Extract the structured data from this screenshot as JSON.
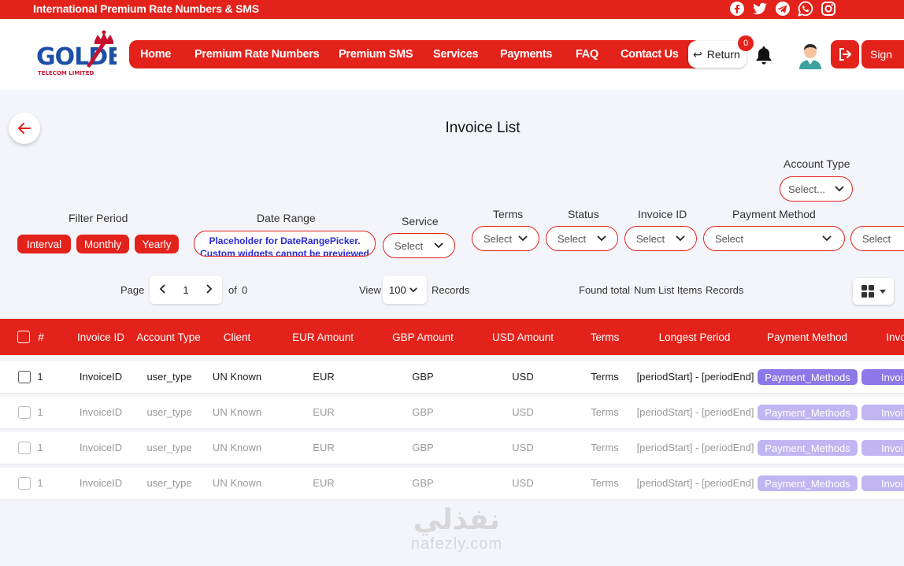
{
  "topbar": {
    "tagline": "International Premium Rate Numbers & SMS",
    "socials": [
      "facebook-icon",
      "twitter-icon",
      "telegram-icon",
      "whatsapp-icon",
      "instagram-icon"
    ]
  },
  "brand": {
    "name": "GOLDEX",
    "subtitle": "TELECOM LIMITED"
  },
  "nav": {
    "items": [
      "Home",
      "Premium Rate Numbers",
      "Premium SMS",
      "Services",
      "Payments",
      "FAQ",
      "Contact Us"
    ],
    "return_label": "Return",
    "notification_count": "0",
    "signin_label": "Sign"
  },
  "page": {
    "title": "Invoice List"
  },
  "filters": {
    "filter_period_label": "Filter Period",
    "period_buttons": [
      "Interval",
      "Monthly",
      "Yearly"
    ],
    "date_range_label": "Date Range",
    "date_range_text": "Placeholder for DateRangePicker. Custom widgets cannot be previewed",
    "service_label": "Service",
    "service_value": "Select",
    "terms_label": "Terms",
    "terms_value": "Select",
    "status_label": "Status",
    "status_value": "Select",
    "invoice_id_label": "Invoice ID",
    "invoice_id_value": "Select",
    "payment_method_label": "Payment Method",
    "payment_method_value": "Select",
    "extra_value": "Select",
    "account_type_label": "Account Type",
    "account_type_value": "Select..."
  },
  "pagination": {
    "page_label": "Page",
    "page_value": "1",
    "of_label": "of",
    "total_pages": "0",
    "view_label": "View",
    "view_value": "100",
    "records_label": "Records",
    "found_label": "Found total",
    "found_value": "Num List Items",
    "found_suffix": "Records"
  },
  "table": {
    "headers": [
      "#",
      "Invoice ID",
      "Account Type",
      "Client",
      "EUR Amount",
      "GBP Amount",
      "USD Amount",
      "Terms",
      "Longest Period",
      "Payment Method",
      "Invo"
    ],
    "rows": [
      {
        "num": "1",
        "invoice_id": "InvoiceID",
        "account_type": "user_type",
        "client": "UN Known",
        "eur": "EUR",
        "gbp": "GBP",
        "usd": "USD",
        "terms": "Terms",
        "period": "[periodStart] - [periodEnd]",
        "payment": "Payment_Methods",
        "invoice": "Invoi"
      },
      {
        "num": "1",
        "invoice_id": "InvoiceID",
        "account_type": "user_type",
        "client": "UN Known",
        "eur": "EUR",
        "gbp": "GBP",
        "usd": "USD",
        "terms": "Terms",
        "period": "[periodStart] - [periodEnd]",
        "payment": "Payment_Methods",
        "invoice": "Invoi"
      },
      {
        "num": "1",
        "invoice_id": "InvoiceID",
        "account_type": "user_type",
        "client": "UN Known",
        "eur": "EUR",
        "gbp": "GBP",
        "usd": "USD",
        "terms": "Terms",
        "period": "[periodStart] - [periodEnd]",
        "payment": "Payment_Methods",
        "invoice": "Invoi"
      },
      {
        "num": "1",
        "invoice_id": "InvoiceID",
        "account_type": "user_type",
        "client": "UN Known",
        "eur": "EUR",
        "gbp": "GBP",
        "usd": "USD",
        "terms": "Terms",
        "period": "[periodStart] - [periodEnd]",
        "payment": "Payment_Methods",
        "invoice": "Invoi"
      }
    ]
  },
  "watermark": {
    "arabic": "نفذلي",
    "latin": "nafezly.com"
  },
  "colors": {
    "brand_red": "#e3221b",
    "tag_purple": "#8c78e6",
    "tag_purple_faded": "#c1b6f1",
    "date_text_blue": "#2b2bd9"
  }
}
